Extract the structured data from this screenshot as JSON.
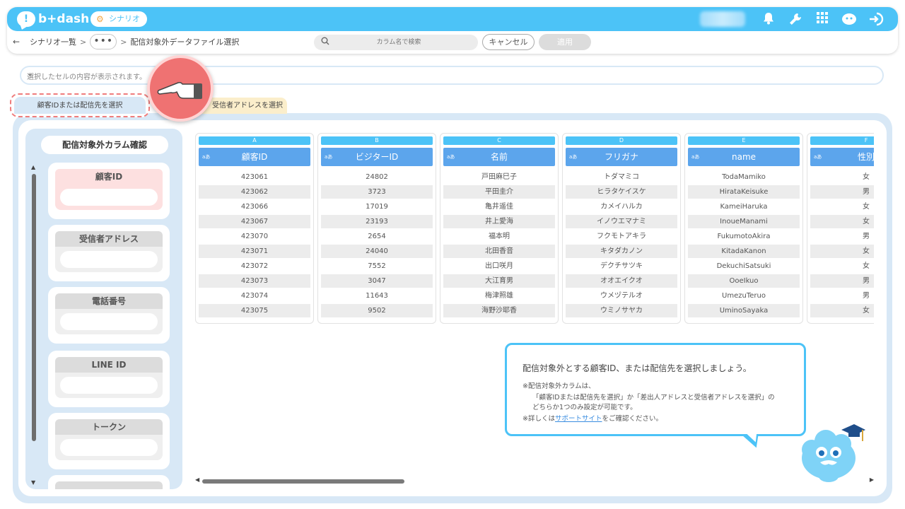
{
  "app": {
    "logo_text": "b+dash",
    "module_chip": "シナリオ"
  },
  "breadcrumb": {
    "root": "シナリオ一覧",
    "separator": ">",
    "dots": "•••",
    "current": "配信対象外データファイル選択"
  },
  "toolbar": {
    "search_placeholder": "カラム名で検索",
    "cancel_label": "キャンセル",
    "apply_label": "適用"
  },
  "cell_bar": {
    "placeholder": "選択したセルの内容が表示されます。"
  },
  "tabs": [
    {
      "label": "顧客IDまたは配信先を選択",
      "active": true
    },
    {
      "label": "受信者アドレスを選択",
      "active": false
    }
  ],
  "left_panel": {
    "title": "配信対象外カラム確認",
    "cards": [
      {
        "label": "顧客ID"
      },
      {
        "label": "受信者アドレス"
      },
      {
        "label": "電話番号"
      },
      {
        "label": "LINE ID"
      },
      {
        "label": "トークン"
      }
    ]
  },
  "grid": {
    "type_tag": "aあ",
    "columns": [
      {
        "letter": "A",
        "header": "顧客ID",
        "cells": [
          "423061",
          "423062",
          "423066",
          "423067",
          "423070",
          "423071",
          "423072",
          "423073",
          "423074",
          "423075"
        ]
      },
      {
        "letter": "B",
        "header": "ビジターID",
        "cells": [
          "24802",
          "3723",
          "17019",
          "23193",
          "2654",
          "24040",
          "7552",
          "3047",
          "11643",
          "9502"
        ]
      },
      {
        "letter": "C",
        "header": "名前",
        "cells": [
          "戸田麻巳子",
          "平田圭介",
          "亀井遥佳",
          "井上愛海",
          "福本明",
          "北田香音",
          "出口咲月",
          "大江育男",
          "梅津照雄",
          "海野沙耶香"
        ]
      },
      {
        "letter": "D",
        "header": "フリガナ",
        "cells": [
          "トダマミコ",
          "ヒラタケイスケ",
          "カメイハルカ",
          "イノウエマナミ",
          "フクモトアキラ",
          "キタダカノン",
          "デクチサツキ",
          "オオエイクオ",
          "ウメヅテルオ",
          "ウミノサヤカ"
        ]
      },
      {
        "letter": "E",
        "header": "name",
        "cells": [
          "TodaMamiko",
          "HirataKeisuke",
          "KameiHaruka",
          "InoueManami",
          "FukumotoAkira",
          "KitadaKanon",
          "DekuchiSatsuki",
          "OoeIkuo",
          "UmezuTeruo",
          "UminoSayaka"
        ]
      },
      {
        "letter": "F",
        "header": "性別",
        "cells": [
          "女",
          "男",
          "女",
          "女",
          "男",
          "女",
          "女",
          "男",
          "男",
          "女"
        ]
      }
    ]
  },
  "info": {
    "main": "配信対象外とする顧客ID、または配信先を選択しましょう。",
    "note1": "※配信対象外カラムは、",
    "note2": "「顧客IDまたは配信先を選択」か「差出人アドレスと受信者アドレスを選択」の",
    "note3": "どちらか1つのみ設定が可能です。",
    "note4_pre": "※詳しくは",
    "note4_link": "サポートサイト",
    "note4_post": "をご確認ください。"
  },
  "colors": {
    "brand": "#4cc3f7",
    "header_blue": "#5ca5ec",
    "panel": "#d8e8f6",
    "highlight": "#ef7272"
  }
}
